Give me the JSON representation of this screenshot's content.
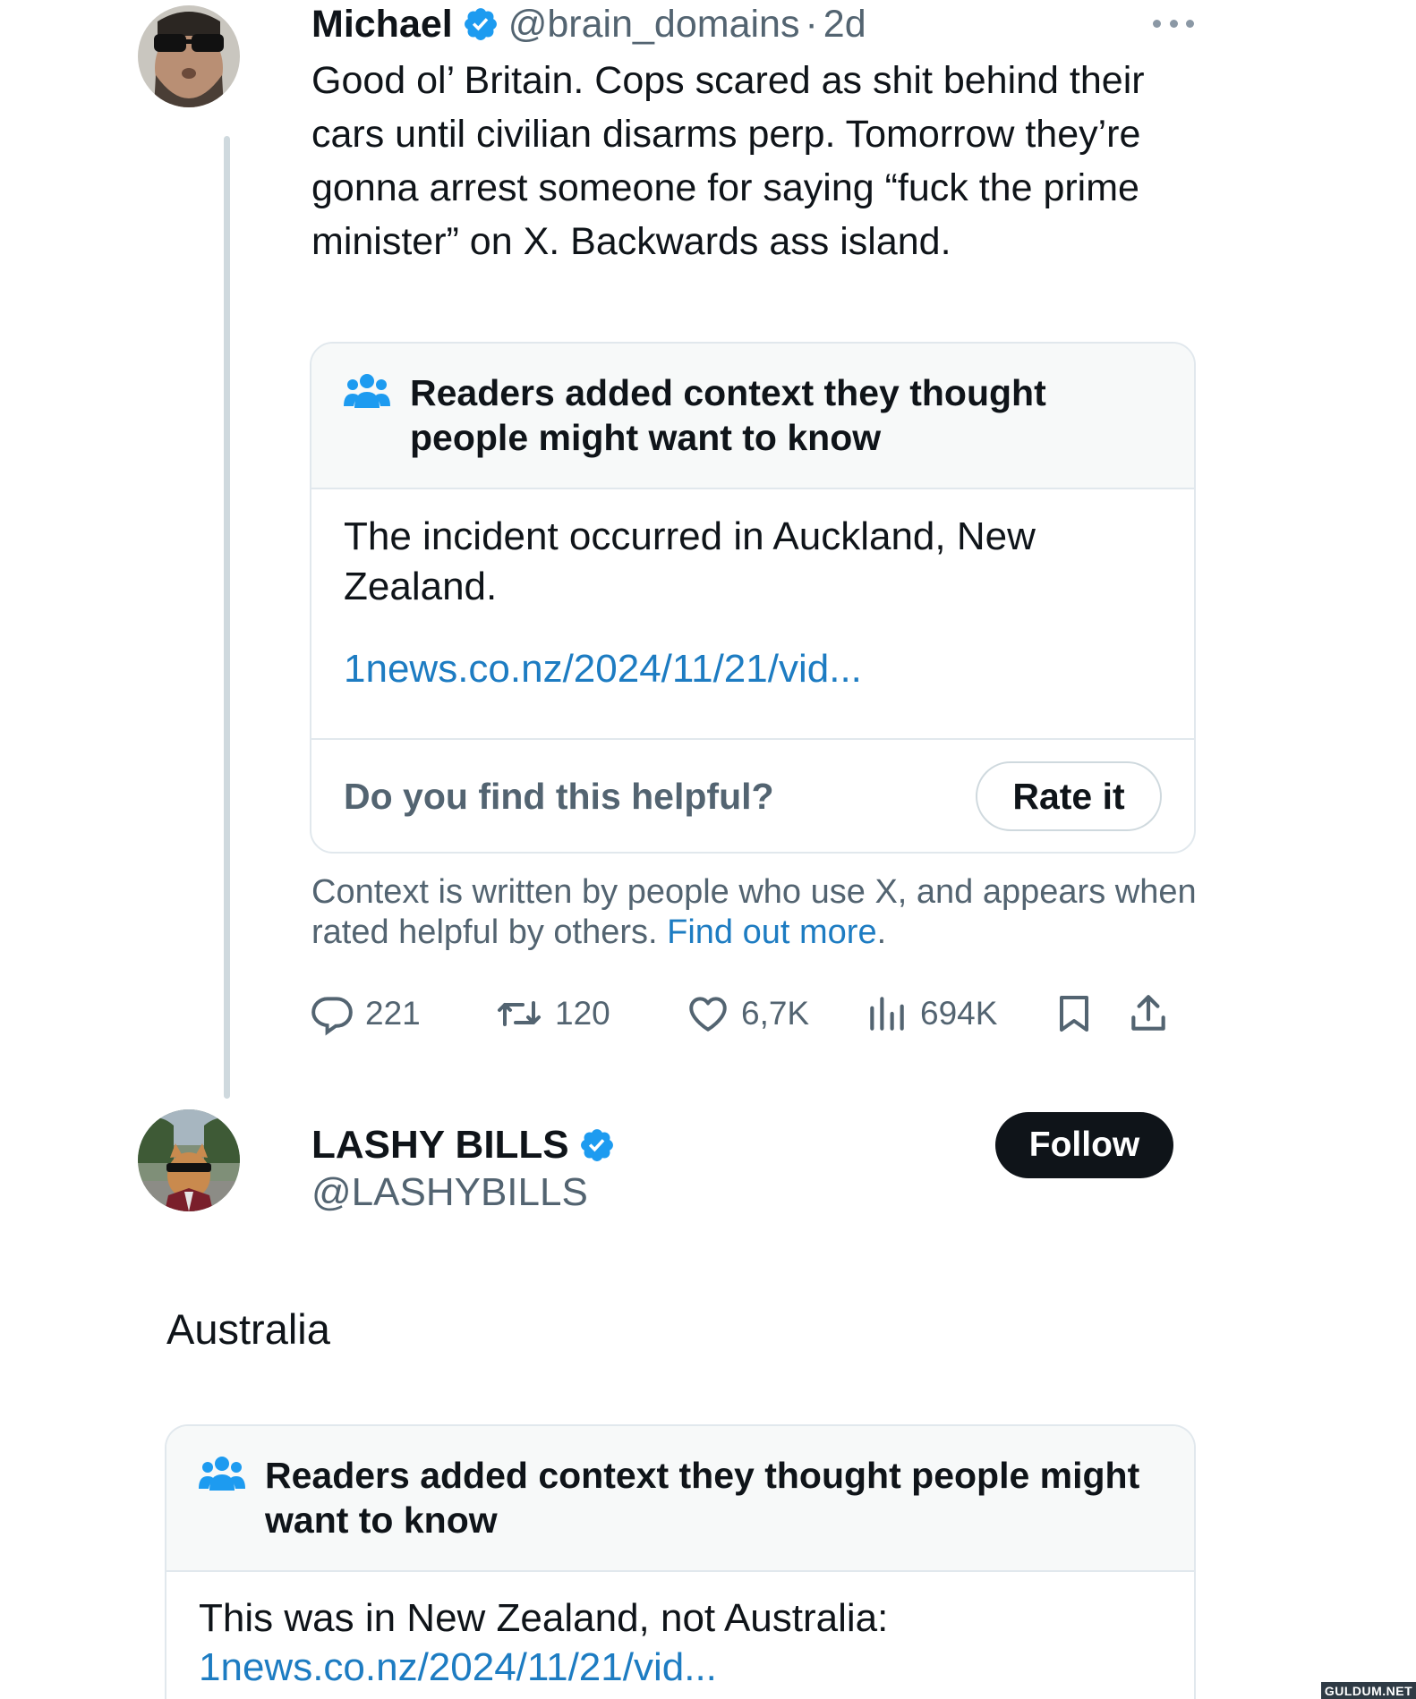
{
  "tweet1": {
    "author_name": "Michael",
    "handle": "@brain_domains",
    "separator": "·",
    "time": "2d",
    "more_icon": "more-horizontal-icon",
    "text": "Good ol’ Britain. Cops scared as shit behind their cars until civilian disarms perp. Tomorrow they’re gonna arrest someone for saying “fuck the prime minister” on X. Backwards ass island.",
    "community_note": {
      "icon": "people-group-icon",
      "title": "Readers added context they thought people might want to know",
      "body": "The incident occurred in Auckland, New Zealand.",
      "link": "1news.co.nz/2024/11/21/vid...",
      "helpful_question": "Do you find this helpful?",
      "rate_label": "Rate it"
    },
    "context_text": "Context is written by people who use X, and appears when rated helpful by others.",
    "context_link": "Find out more",
    "context_end": ".",
    "actions": {
      "replies": "221",
      "reposts": "120",
      "likes": "6,7K",
      "views": "694K"
    }
  },
  "tweet2": {
    "author_name": "LASHY BILLS",
    "handle": "@LASHYBILLS",
    "follow_label": "Follow",
    "text": "Australia",
    "community_note": {
      "icon": "people-group-icon",
      "title": "Readers added context they thought people might want to know",
      "body": "This was in New Zealand, not Australia:",
      "link": "1news.co.nz/2024/11/21/vid..."
    }
  },
  "watermark": "GULDUM.NET",
  "colors": {
    "verified": "#1d9bf0",
    "link": "#1d7cc2",
    "secondary_text": "#536471",
    "note_header_bg": "#f7f9f9",
    "follow_bg": "#0f1419"
  }
}
